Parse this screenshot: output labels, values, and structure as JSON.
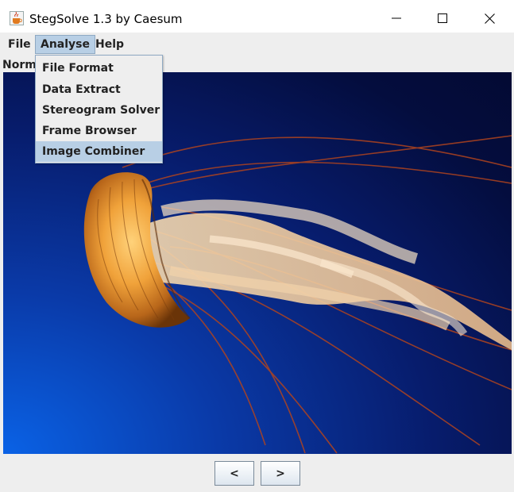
{
  "window": {
    "title": "StegSolve 1.3 by Caesum",
    "app_icon": "java-cup-icon",
    "controls": [
      "minimize-icon",
      "maximize-icon",
      "close-icon"
    ]
  },
  "menubar": {
    "items": [
      {
        "label": "File"
      },
      {
        "label": "Analyse",
        "active": true
      },
      {
        "label": "Help"
      }
    ]
  },
  "analyse_menu": {
    "items": [
      {
        "label": "File Format"
      },
      {
        "label": "Data Extract"
      },
      {
        "label": "Stereogram Solver"
      },
      {
        "label": "Frame Browser"
      },
      {
        "label": "Image Combiner",
        "highlighted": true
      }
    ]
  },
  "view": {
    "mode_label": "Norma",
    "image_subject": "jellyfish photograph"
  },
  "nav": {
    "prev_label": "<",
    "next_label": ">"
  },
  "colors": {
    "menu_highlight": "#b8cfe5",
    "window_bg": "#eeeeee"
  }
}
